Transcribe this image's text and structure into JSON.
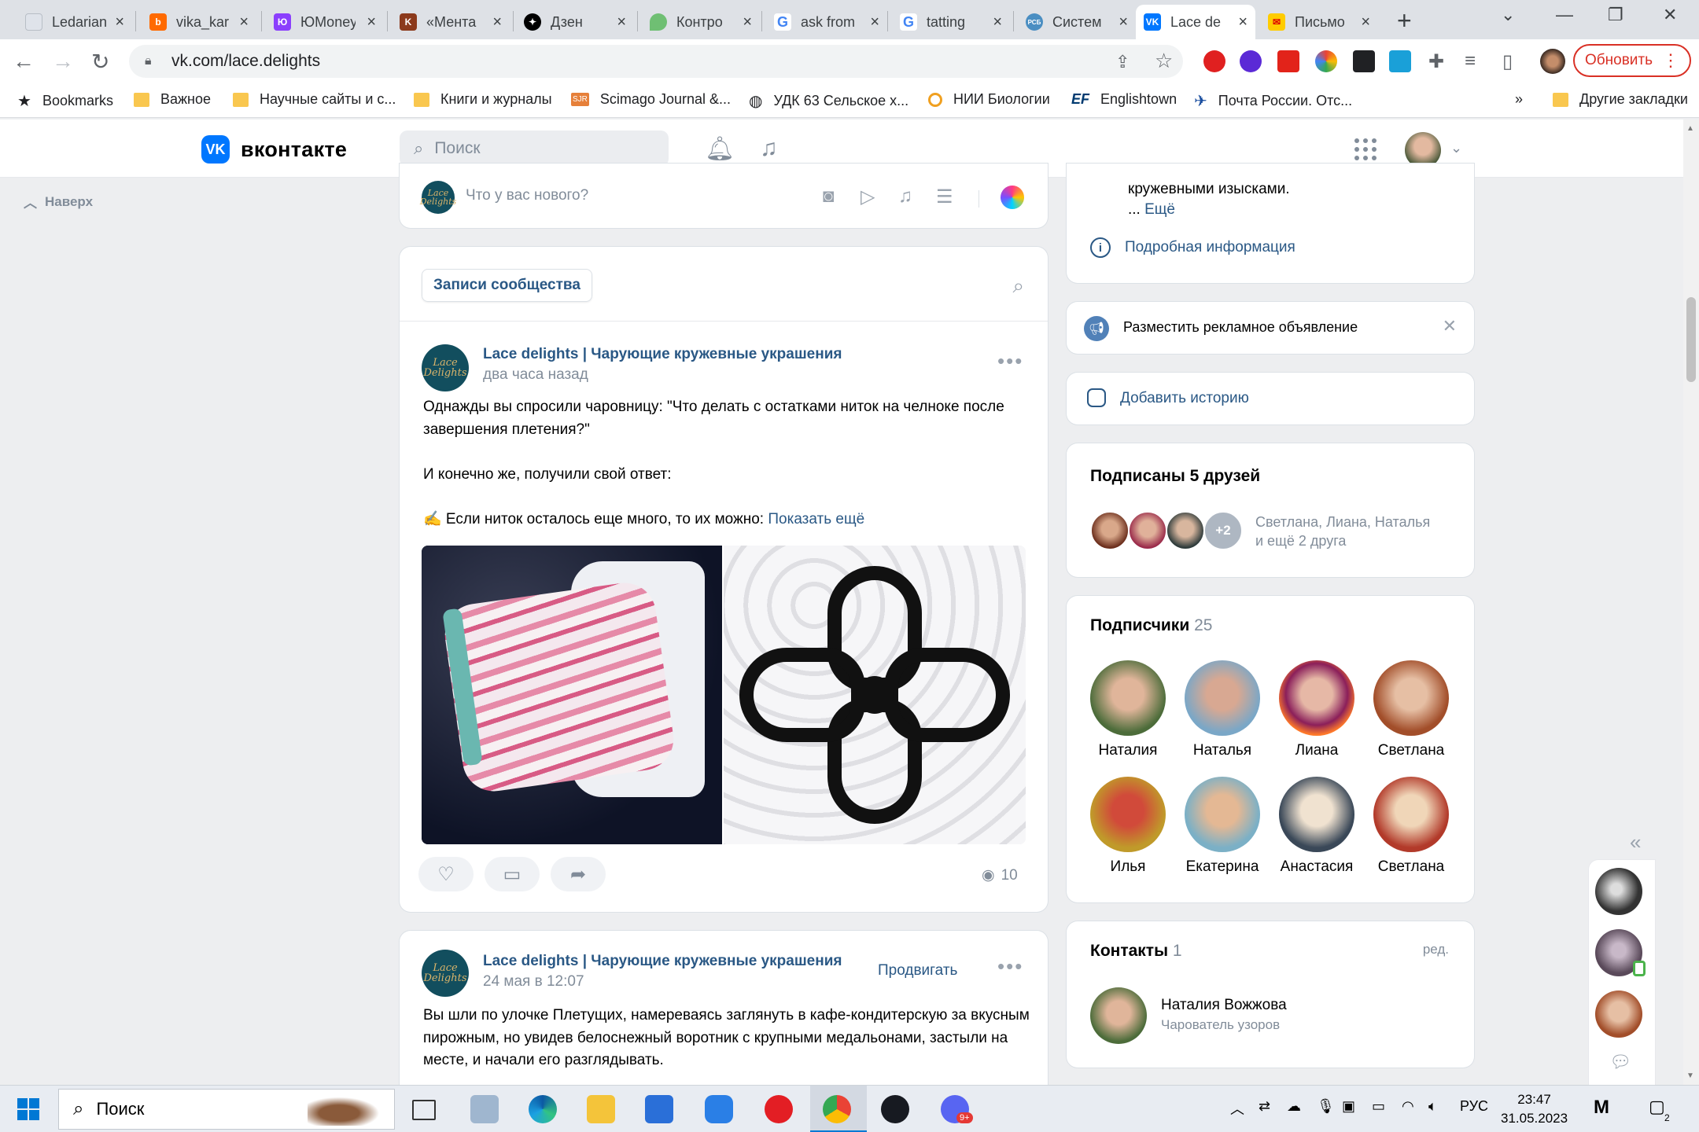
{
  "browser": {
    "tabs": [
      {
        "label": "Ledarian",
        "color": "#dfe3ea"
      },
      {
        "label": "vika_kar",
        "color": "#ff6a00"
      },
      {
        "label": "ЮMoney",
        "color": "#8b3ffd"
      },
      {
        "label": "«Мента",
        "color": "#8c3a1c"
      },
      {
        "label": "Дзен",
        "color": "#000000"
      },
      {
        "label": "Контро",
        "color": "#6fbf73"
      },
      {
        "label": "ask from",
        "color": "#4285f4"
      },
      {
        "label": "tatting",
        "color": "#4285f4"
      },
      {
        "label": "Систем",
        "color": "#4a8ec2"
      },
      {
        "label": "Lace de",
        "color": "#0077ff"
      },
      {
        "label": "Письмо",
        "color": "#ffcc00"
      }
    ],
    "url": "vk.com/lace.delights",
    "update_button": "Обновить",
    "bookmarks": [
      "Bookmarks",
      "Важное",
      "Научные сайты и с...",
      "Книги и журналы",
      "Scimago Journal &...",
      "УДК 63 Сельское х...",
      "НИИ Биологии",
      "Englishtown",
      "Почта России. Отс..."
    ],
    "bookmarks_overflow": "»",
    "other_bookmarks": "Другие закладки"
  },
  "vk": {
    "logo": "вконтакте",
    "search_placeholder": "Поиск",
    "back_top": "Наверх",
    "new_post_placeholder": "Что у вас нового?",
    "community_posts_tab": "Записи сообщества",
    "posts": [
      {
        "author": "Lace delights | Чарующие кружевные украшения",
        "time": "два часа назад",
        "text_p1": "Однажды вы спросили чаровницу: \"Что делать с остатками ниток на челноке после завершения плетения?\"",
        "text_p2": "И конечно же, получили свой ответ:",
        "text_p3": "✍️ Если ниток осталось еще много, то их можно:",
        "show_more": "Показать ещё",
        "views": "10"
      },
      {
        "author": "Lace delights | Чарующие кружевные украшения",
        "time": "24 мая в 12:07",
        "promote": "Продвигать",
        "text": "Вы шли по улочке Плетущих, намереваясь заглянуть в кафе-кондитерскую за вкусным пирожным, но увидев белоснежный воротник с крупными медальонами, застыли на месте, и начали его разглядывать."
      }
    ],
    "about": {
      "line": "кружевными изысками.",
      "more_prefix": "...",
      "more": "Ещё",
      "details": "Подробная информация"
    },
    "ad": "Разместить рекламное объявление",
    "add_story": "Добавить историю",
    "friends_block": {
      "title": "Подписаны 5 друзей",
      "more_badge": "+2",
      "names": "Светлана, Лиана, Наталья",
      "and_more": "и ещё 2 друга"
    },
    "followers": {
      "title": "Подписчики",
      "count": "25",
      "people": [
        {
          "name": "Наталия"
        },
        {
          "name": "Наталья"
        },
        {
          "name": "Лиана"
        },
        {
          "name": "Светлана"
        },
        {
          "name": "Илья"
        },
        {
          "name": "Екатерина"
        },
        {
          "name": "Анастасия"
        },
        {
          "name": "Светлана"
        }
      ]
    },
    "contacts": {
      "title": "Контакты",
      "count": "1",
      "edit": "ред.",
      "name": "Наталия Вожжова",
      "role": "Чарователь узоров"
    }
  },
  "taskbar": {
    "search": "Поиск",
    "lang": "РУС",
    "time": "23:47",
    "date": "31.05.2023",
    "notif_count": "2",
    "discord_badge": "9+"
  }
}
